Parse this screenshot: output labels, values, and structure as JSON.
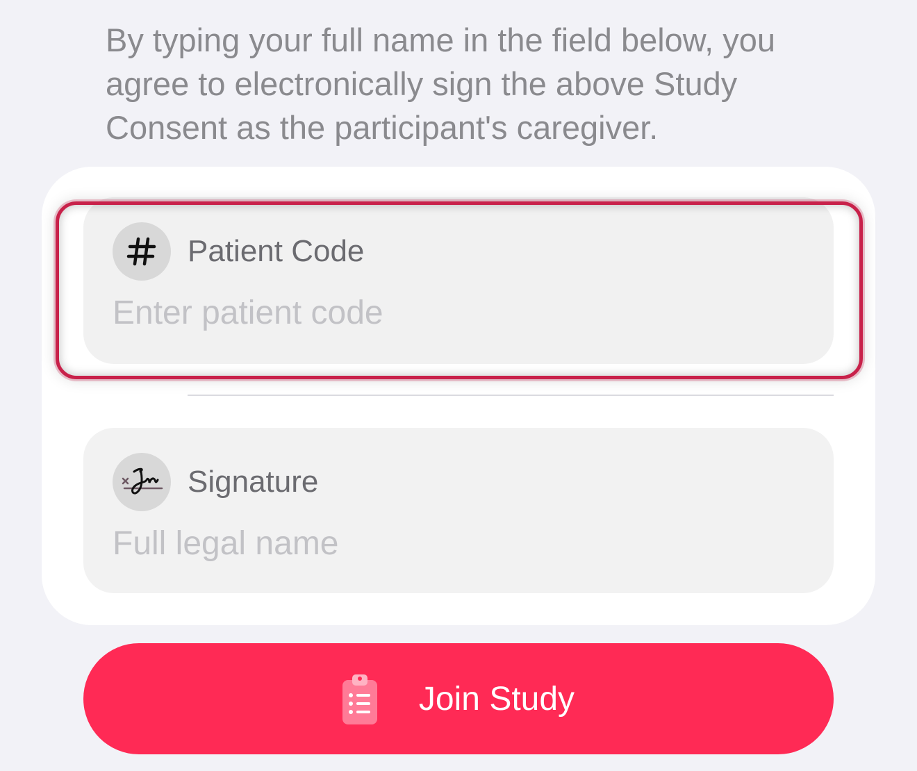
{
  "consent": {
    "text": "By typing your full name in the field below, you agree to electronically sign the above Study Consent as the participant's caregiver."
  },
  "fields": {
    "patient_code": {
      "icon": "hashtag-icon",
      "label": "Patient Code",
      "placeholder": "Enter patient code",
      "value": "",
      "focused": true
    },
    "signature": {
      "icon": "signature-icon",
      "label": "Signature",
      "placeholder": "Full legal name",
      "value": ""
    }
  },
  "join_button": {
    "icon": "clipboard-list-icon",
    "label": "Join Study"
  },
  "colors": {
    "accent": "#ff2a55",
    "focus_ring": "#c8214a",
    "background": "#f2f2f7",
    "placeholder": "#c2c2c6"
  }
}
